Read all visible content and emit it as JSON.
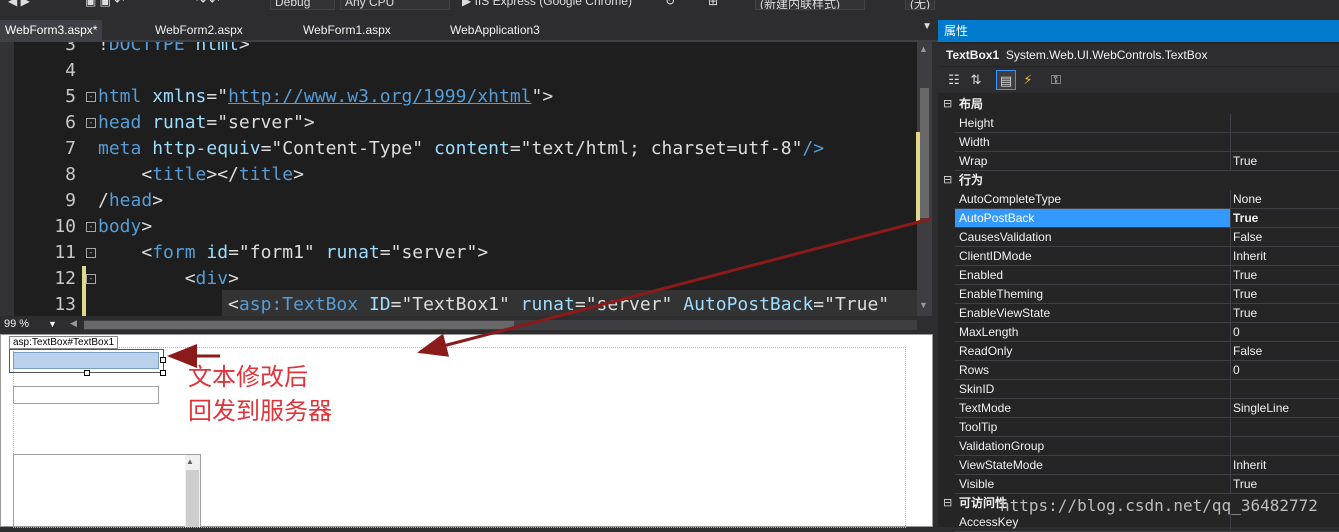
{
  "toolbar": {
    "config": "Debug",
    "platform": "Any CPU",
    "run_target": "IIS Express (Google Chrome)",
    "search_placeholder": "(新建内联样式)",
    "zoom_combo": "(无)"
  },
  "tabs": [
    {
      "label": "WebForm3.aspx*",
      "active": true
    },
    {
      "label": "WebForm2.aspx",
      "active": false
    },
    {
      "label": "WebForm1.aspx",
      "active": false
    },
    {
      "label": "WebApplication3",
      "active": false
    }
  ],
  "editor": {
    "zoom": "99 %",
    "lines": [
      {
        "num": "3",
        "fold": "",
        "parts": [
          {
            "t": "!",
            "c": "tx"
          },
          {
            "t": "DOCTYPE",
            "c": "kw"
          },
          {
            "t": " html",
            "c": "at"
          },
          {
            "t": ">",
            "c": "tx"
          }
        ]
      },
      {
        "num": "4",
        "fold": "",
        "parts": []
      },
      {
        "num": "5",
        "fold": "-",
        "parts": [
          {
            "t": "html ",
            "c": "kw"
          },
          {
            "t": "xmlns",
            "c": "at"
          },
          {
            "t": "=\"",
            "c": "tx"
          },
          {
            "t": "http://www.w3.org/1999/xhtml",
            "c": "lk"
          },
          {
            "t": "\">",
            "c": "tx"
          }
        ]
      },
      {
        "num": "6",
        "fold": "-",
        "parts": [
          {
            "t": "head ",
            "c": "kw"
          },
          {
            "t": "runat",
            "c": "at"
          },
          {
            "t": "=\"server\">",
            "c": "tx"
          }
        ]
      },
      {
        "num": "7",
        "fold": "",
        "parts": [
          {
            "t": "meta ",
            "c": "kw"
          },
          {
            "t": "http-equiv",
            "c": "at"
          },
          {
            "t": "=\"Content-Type\" ",
            "c": "tx"
          },
          {
            "t": "content",
            "c": "at"
          },
          {
            "t": "=\"text/html; charset=utf-8\"",
            "c": "tx"
          },
          {
            "t": "/>",
            "c": "kw"
          }
        ]
      },
      {
        "num": "8",
        "fold": "",
        "parts": [
          {
            "t": "    <",
            "c": "tx"
          },
          {
            "t": "title",
            "c": "kw"
          },
          {
            "t": "></",
            "c": "tx"
          },
          {
            "t": "title",
            "c": "kw"
          },
          {
            "t": ">",
            "c": "tx"
          }
        ]
      },
      {
        "num": "9",
        "fold": "",
        "parts": [
          {
            "t": "/",
            "c": "tx"
          },
          {
            "t": "head",
            "c": "kw"
          },
          {
            "t": ">",
            "c": "tx"
          }
        ]
      },
      {
        "num": "10",
        "fold": "-",
        "parts": [
          {
            "t": "body",
            "c": "kw"
          },
          {
            "t": ">",
            "c": "tx"
          }
        ]
      },
      {
        "num": "11",
        "fold": "-",
        "parts": [
          {
            "t": "    <",
            "c": "tx"
          },
          {
            "t": "form ",
            "c": "kw"
          },
          {
            "t": "id",
            "c": "at"
          },
          {
            "t": "=\"form1\" ",
            "c": "tx"
          },
          {
            "t": "runat",
            "c": "at"
          },
          {
            "t": "=\"server\">",
            "c": "tx"
          }
        ]
      },
      {
        "num": "12",
        "fold": "-",
        "parts": [
          {
            "t": "        <",
            "c": "tx"
          },
          {
            "t": "div",
            "c": "kw"
          },
          {
            "t": ">",
            "c": "tx"
          }
        ]
      },
      {
        "num": "13",
        "fold": "",
        "parts": [
          {
            "t": "            <",
            "c": "tx"
          },
          {
            "t": "asp:TextBox ",
            "c": "kw"
          },
          {
            "t": "ID",
            "c": "at"
          },
          {
            "t": "=\"TextBox1\" ",
            "c": "tx"
          },
          {
            "t": "runat",
            "c": "at"
          },
          {
            "t": "=\"server\" ",
            "c": "tx"
          },
          {
            "t": "AutoPostBack",
            "c": "at"
          },
          {
            "t": "=\"True\"",
            "c": "tx"
          }
        ]
      }
    ]
  },
  "design": {
    "tag_label": "asp:TextBox#TextBox1"
  },
  "annotation": {
    "line1": "文本修改后",
    "line2": "回发到服务器"
  },
  "properties": {
    "panel_title": "属性",
    "object_name": "TextBox1",
    "object_type": "System.Web.UI.WebControls.TextBox",
    "rows": [
      {
        "kind": "cat",
        "name": "布局",
        "value": ""
      },
      {
        "kind": "prop",
        "name": "Height",
        "value": ""
      },
      {
        "kind": "prop",
        "name": "Width",
        "value": ""
      },
      {
        "kind": "prop",
        "name": "Wrap",
        "value": "True"
      },
      {
        "kind": "cat",
        "name": "行为",
        "value": ""
      },
      {
        "kind": "prop",
        "name": "AutoCompleteType",
        "value": "None"
      },
      {
        "kind": "sel",
        "name": "AutoPostBack",
        "value": "True"
      },
      {
        "kind": "prop",
        "name": "CausesValidation",
        "value": "False"
      },
      {
        "kind": "prop",
        "name": "ClientIDMode",
        "value": "Inherit"
      },
      {
        "kind": "prop",
        "name": "Enabled",
        "value": "True"
      },
      {
        "kind": "prop",
        "name": "EnableTheming",
        "value": "True"
      },
      {
        "kind": "prop",
        "name": "EnableViewState",
        "value": "True"
      },
      {
        "kind": "prop",
        "name": "MaxLength",
        "value": "0"
      },
      {
        "kind": "prop",
        "name": "ReadOnly",
        "value": "False"
      },
      {
        "kind": "prop",
        "name": "Rows",
        "value": "0"
      },
      {
        "kind": "prop",
        "name": "SkinID",
        "value": ""
      },
      {
        "kind": "prop",
        "name": "TextMode",
        "value": "SingleLine"
      },
      {
        "kind": "prop",
        "name": "ToolTip",
        "value": ""
      },
      {
        "kind": "prop",
        "name": "ValidationGroup",
        "value": ""
      },
      {
        "kind": "prop",
        "name": "ViewStateMode",
        "value": "Inherit"
      },
      {
        "kind": "prop",
        "name": "Visible",
        "value": "True"
      },
      {
        "kind": "cat",
        "name": "可访问性",
        "value": ""
      },
      {
        "kind": "prop",
        "name": "AccessKey",
        "value": ""
      }
    ]
  },
  "watermark": "https://blog.csdn.net/qq_36482772",
  "colors": {
    "accent": "#007acc",
    "selection": "#3399ff",
    "annotation": "#e0333a",
    "arrow": "#8b1a1a"
  }
}
